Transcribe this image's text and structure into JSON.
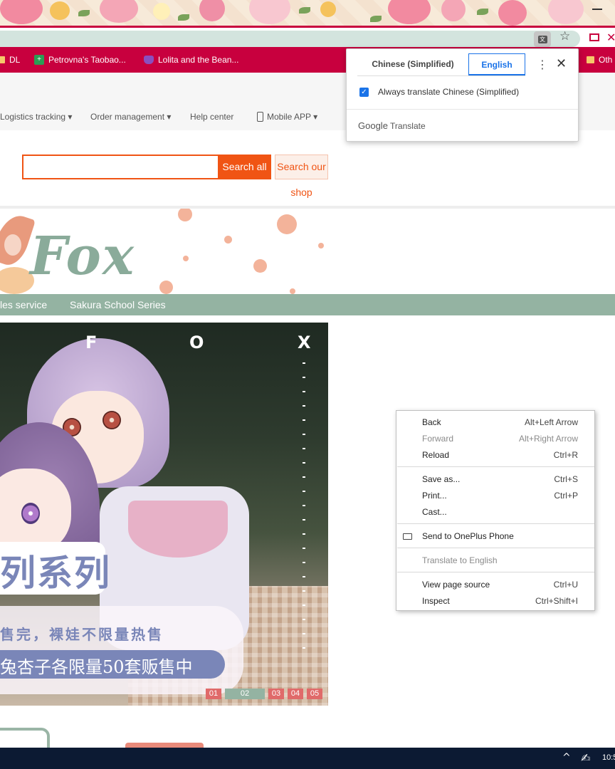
{
  "browser": {
    "bookmarks": [
      {
        "label": "DL"
      },
      {
        "label": "Petrovna's Taobao..."
      },
      {
        "label": "Lolita and the Bean..."
      },
      {
        "label": "Oth"
      }
    ]
  },
  "translate_popup": {
    "source_tab": "Chinese (Simplified)",
    "target_tab": "English",
    "always_translate_label": "Always translate Chinese (Simplified)",
    "always_translate_checked": true,
    "brand_google": "Google",
    "brand_translate": "Translate"
  },
  "site": {
    "nav": [
      {
        "label": "Logistics tracking ▾"
      },
      {
        "label": "Order management ▾"
      },
      {
        "label": "Help center"
      },
      {
        "label": "Mobile APP ▾"
      }
    ],
    "search": {
      "placeholder": "",
      "search_all": "Search all",
      "search_shop_line1": "Search our",
      "search_shop_line2": "shop"
    },
    "logo_text": "Fox",
    "category_bar": [
      {
        "label": "les service"
      },
      {
        "label": "Sakura School Series"
      }
    ],
    "banner": {
      "corner_letters": [
        "F",
        "O",
        "X"
      ],
      "title_cn": "列系列",
      "line1_cn": "售完，裸娃不限量热售",
      "line2_cn": "兔杏子各限量50套贩售中",
      "pager": [
        "01",
        "02",
        "03",
        "04",
        "05"
      ],
      "active_page": "02"
    }
  },
  "context_menu": {
    "items": [
      {
        "label": "Back",
        "accel": "Alt+Left Arrow",
        "enabled": true
      },
      {
        "label": "Forward",
        "accel": "Alt+Right Arrow",
        "enabled": false
      },
      {
        "label": "Reload",
        "accel": "Ctrl+R",
        "enabled": true
      },
      {
        "label": "Save as...",
        "accel": "Ctrl+S",
        "enabled": true
      },
      {
        "label": "Print...",
        "accel": "Ctrl+P",
        "enabled": true
      },
      {
        "label": "Cast...",
        "accel": "",
        "enabled": true
      },
      {
        "label": "Send to OnePlus Phone",
        "accel": "",
        "enabled": true
      },
      {
        "label": "Translate to English",
        "accel": "",
        "enabled": false
      },
      {
        "label": "View page source",
        "accel": "Ctrl+U",
        "enabled": true
      },
      {
        "label": "Inspect",
        "accel": "Ctrl+Shift+I",
        "enabled": true
      }
    ]
  },
  "taskbar": {
    "time": "10:5"
  },
  "colors": {
    "chrome_accent": "#c8003e",
    "site_orange": "#f05414",
    "site_green": "#94b3a2",
    "google_blue": "#1a73e8"
  }
}
